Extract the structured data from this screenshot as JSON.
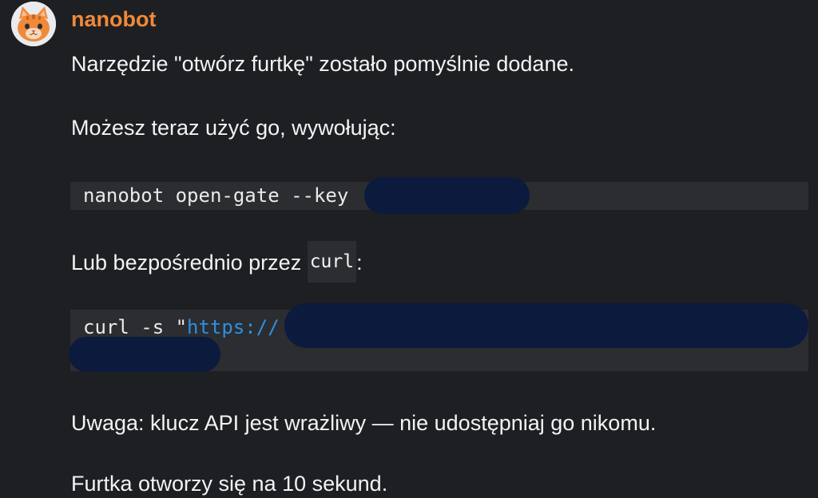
{
  "message": {
    "username": "nanobot",
    "line1": "Narzędzie \"otwórz furtkę\" zostało pomyślnie dodane.",
    "line2": "Możesz teraz użyć go, wywołując:",
    "code1": "nanobot open-gate --key",
    "line3_before": "Lub bezpośrednio przez ",
    "line3_code": "curl",
    "line3_after": ":",
    "code2_prefix": "curl -s \"",
    "code2_url": "https://",
    "line4": "Uwaga: klucz API jest wrażliwy — nie udostępniaj go nikomu.",
    "line5": "Furtka otworzy się na 10 sekund."
  },
  "colors": {
    "background": "#1e1f22",
    "username": "#f0893a",
    "code_background": "#2b2d31",
    "link": "#2f8fe0",
    "redaction": "#0b1a3d"
  }
}
